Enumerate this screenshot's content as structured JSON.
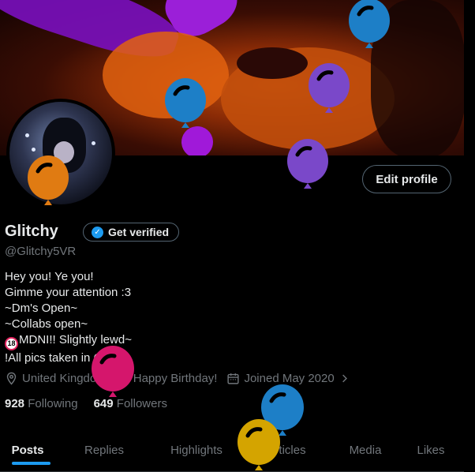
{
  "profile": {
    "display_name": "Glitchy",
    "handle": "@Glitchy5VR",
    "verify_label": "Get verified",
    "edit_label": "Edit profile"
  },
  "bio": {
    "lines": [
      "Hey you! Ye you!",
      "Gimme your attention :3",
      "~Dm's Open~",
      "~Collabs open~",
      "MDNI!! Slightly lewd~",
      "!All pics taken in CVR!"
    ],
    "mdni_badge": "18"
  },
  "meta": {
    "location": "United Kingdom",
    "birthday": "Happy Birthday!",
    "joined": "Joined May 2020"
  },
  "stats": {
    "following_count": "928",
    "following_label": "Following",
    "followers_count": "649",
    "followers_label": "Followers"
  },
  "tabs": [
    "Posts",
    "Replies",
    "Highlights",
    "Articles",
    "Media",
    "Likes"
  ],
  "colors": {
    "accent": "#1d9bf0",
    "muted": "#71767b",
    "balloon_blue": "#1d7fc7",
    "balloon_purple": "#7a48c9",
    "balloon_orange": "#e07b12",
    "balloon_pink": "#d5166c",
    "balloon_yellow": "#d4a400"
  }
}
